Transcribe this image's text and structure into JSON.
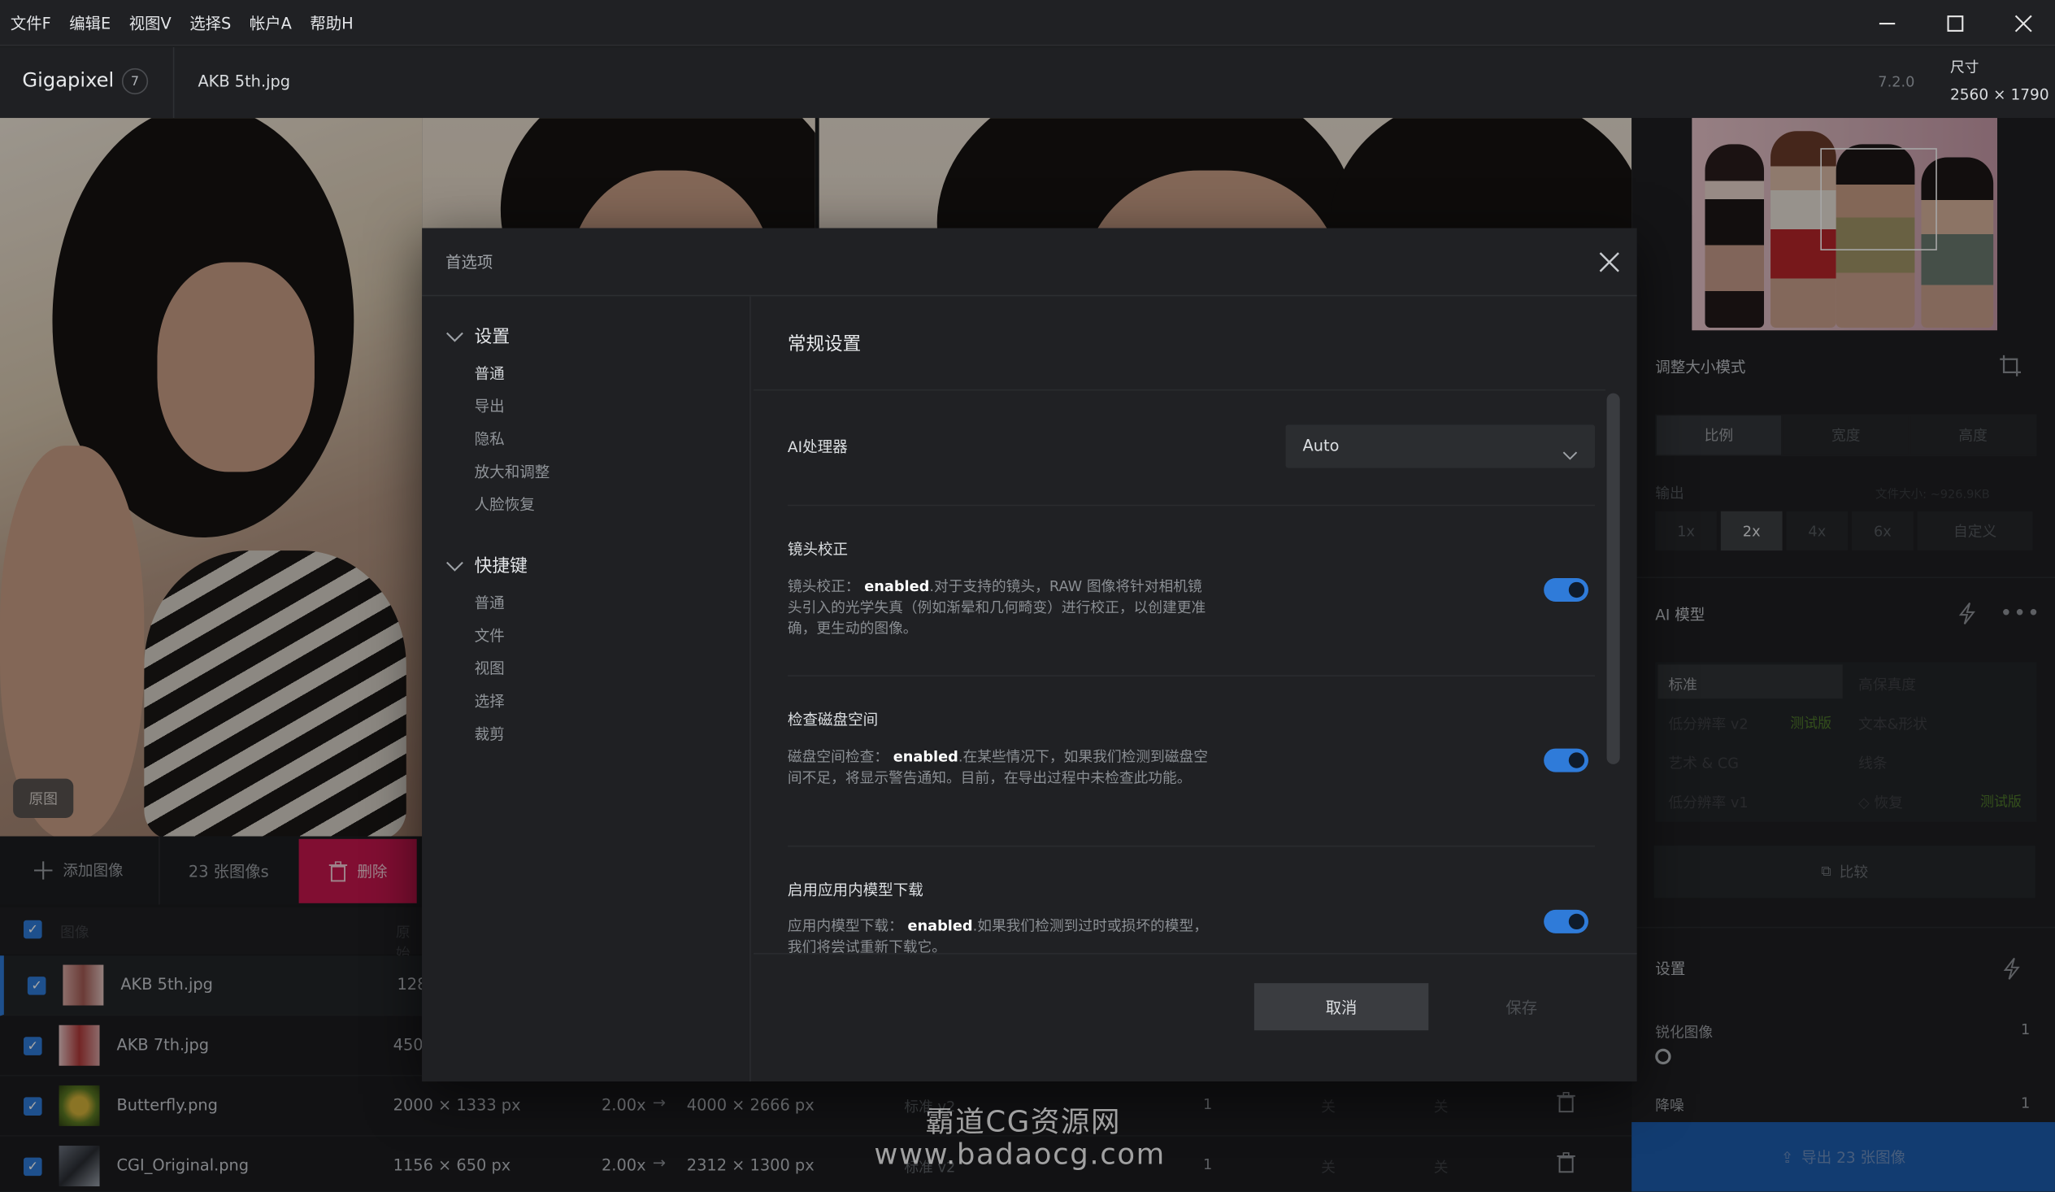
{
  "menu": [
    "文件F",
    "编辑E",
    "视图V",
    "选择S",
    "帐户A",
    "帮助H"
  ],
  "header": {
    "brand": "Gigapixel",
    "count": "7",
    "file_name": "AKB 5th.jpg",
    "version": "7.2.0",
    "size_label": "尺寸",
    "size_value": "2560 × 1790"
  },
  "viewer": {
    "original_label": "原图"
  },
  "list": {
    "add_label": "添加图像",
    "count_label": "23 张图像s",
    "delete_label": "删除",
    "col_image": "图像",
    "col_original": "原始",
    "rows": [
      {
        "name": "AKB 5th.jpg",
        "dim": "128",
        "scale": "",
        "out": "",
        "model": "",
        "num": "",
        "off1": "",
        "off2": ""
      },
      {
        "name": "AKB 7th.jpg",
        "dim": "450",
        "scale": "",
        "out": "",
        "model": "",
        "num": "",
        "off1": "",
        "off2": ""
      },
      {
        "name": "Butterfly.png",
        "dim": "2000 × 1333 px",
        "scale": "2.00x",
        "out": "4000 × 2666 px",
        "model": "标准 v2",
        "num": "1",
        "off1": "关",
        "off2": "关"
      },
      {
        "name": "CGI_Original.png",
        "dim": "1156 × 650 px",
        "scale": "2.00x",
        "out": "2312 × 1300 px",
        "model": "标准 v2",
        "num": "1",
        "off1": "关",
        "off2": "关"
      }
    ]
  },
  "right_panel": {
    "resize_mode": "调整大小模式",
    "resize_tabs": [
      "比例",
      "宽度",
      "高度"
    ],
    "output_label": "输出",
    "file_size": "文件大小: ~926.9KB",
    "scales": [
      "1x",
      "2x",
      "4x",
      "6x",
      "自定义"
    ],
    "ai_model": "AI 模型",
    "models": [
      {
        "label": "标准",
        "badge": ""
      },
      {
        "label": "高保真度",
        "badge": ""
      },
      {
        "label": "低分辨率 v2",
        "badge": "测试版"
      },
      {
        "label": "文本&形状",
        "badge": ""
      },
      {
        "label": "艺术 & CG",
        "badge": ""
      },
      {
        "label": "线条",
        "badge": ""
      },
      {
        "label": "低分辨率 v1",
        "badge": ""
      },
      {
        "label": "恢复",
        "badge": "测试版"
      }
    ],
    "compare": "比较",
    "settings": "设置",
    "sharpen": "锐化图像",
    "sharpen_val": "1",
    "denoise": "降噪",
    "denoise_val": "1",
    "export": "导出 23 张图像"
  },
  "dialog": {
    "title": "首选项",
    "nav": {
      "settings": "设置",
      "settings_items": [
        "普通",
        "导出",
        "隐私",
        "放大和调整",
        "人脸恢复"
      ],
      "shortcuts": "快捷键",
      "shortcut_items": [
        "普通",
        "文件",
        "视图",
        "选择",
        "裁剪"
      ]
    },
    "content_title": "常规设置",
    "ai_processor": {
      "label": "AI处理器",
      "value": "Auto"
    },
    "lens": {
      "title": "镜头校正",
      "prefix": "镜头校正：",
      "state": "enabled",
      "desc": ".对于支持的镜头，RAW 图像将针对相机镜头引入的光学失真（例如渐晕和几何畸变）进行校正，以创建更准确，更生动的图像。"
    },
    "disk": {
      "title": "检查磁盘空间",
      "prefix": "磁盘空间检查：",
      "state": "enabled",
      "desc": ".在某些情况下，如果我们检测到磁盘空间不足，将显示警告通知。目前，在导出过程中未检查此功能。"
    },
    "download": {
      "title": "启用应用内模型下载",
      "prefix": "应用内模型下载：",
      "state": "enabled",
      "desc": ".如果我们检测到过时或损坏的模型，我们将尝试重新下载它。"
    },
    "cancel": "取消",
    "save": "保存"
  },
  "watermark": {
    "line1": "霸道CG资源网",
    "line2": "www.badaocg.com"
  }
}
